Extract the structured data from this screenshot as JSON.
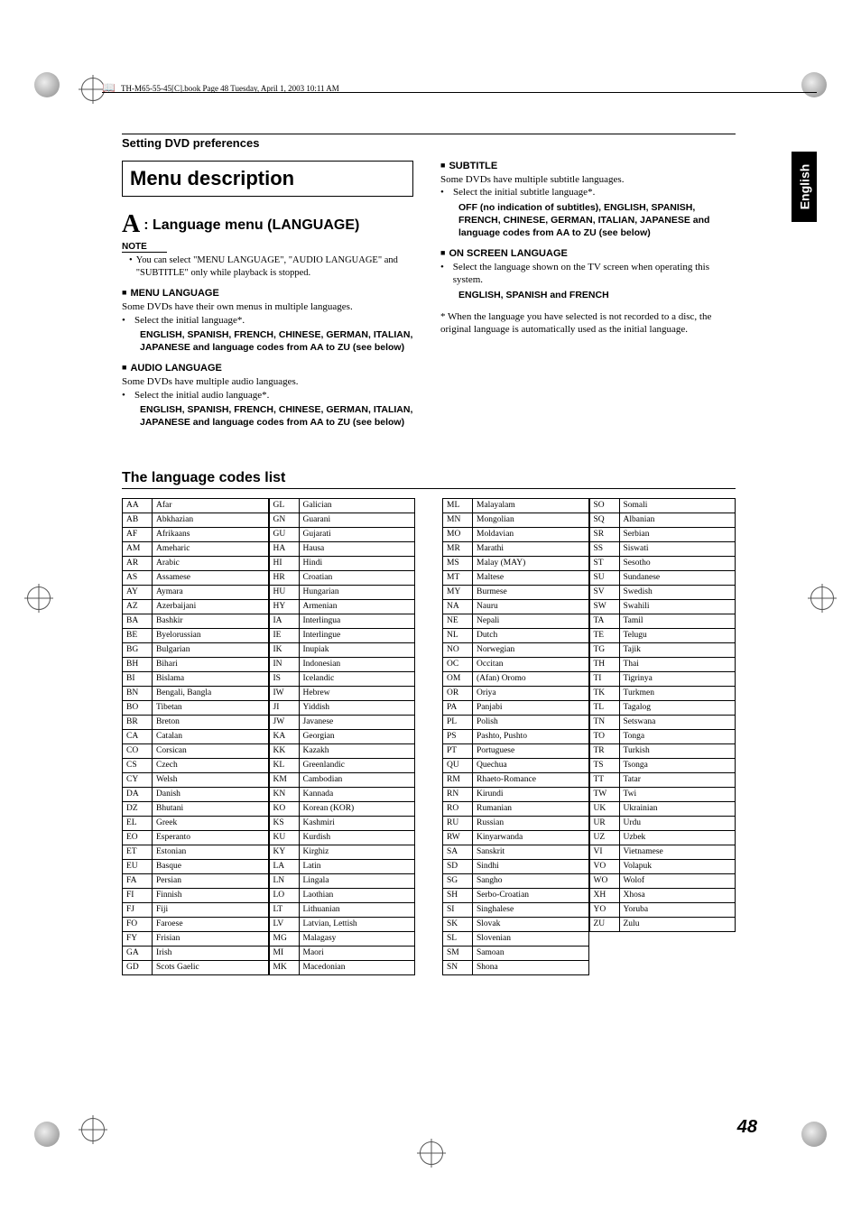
{
  "header": {
    "doc_info": "TH-M65-55-45[C].book  Page 48  Tuesday, April 1, 2003  10:11 AM"
  },
  "side_tab": "English",
  "section_label": "Setting DVD preferences",
  "title": "Menu description",
  "lang_menu_heading": ": Language menu (LANGUAGE)",
  "note_label": "NOTE",
  "note_text": "You can select \"MENU LANGUAGE\", \"AUDIO LANGUAGE\" and \"SUBTITLE\" only while playback is stopped.",
  "menu_lang": {
    "head": "MENU LANGUAGE",
    "line1": "Some DVDs have their own menus in multiple languages.",
    "line2": "Select the initial language*.",
    "bold": "ENGLISH, SPANISH, FRENCH, CHINESE, GERMAN, ITALIAN, JAPANESE and language codes from AA to ZU (see below)"
  },
  "audio_lang": {
    "head": "AUDIO LANGUAGE",
    "line1": "Some DVDs have multiple audio languages.",
    "line2": "Select the initial audio language*.",
    "bold": "ENGLISH, SPANISH, FRENCH, CHINESE, GERMAN, ITALIAN, JAPANESE and language codes from AA to ZU (see below)"
  },
  "subtitle": {
    "head": "SUBTITLE",
    "line1": "Some DVDs have multiple subtitle languages.",
    "line2": "Select the initial subtitle language*.",
    "bold": "OFF (no indication of subtitles), ENGLISH, SPANISH, FRENCH, CHINESE, GERMAN, ITALIAN, JAPANESE and language codes from AA to ZU (see below)"
  },
  "osd": {
    "head": "ON SCREEN LANGUAGE",
    "line1": "Select the language shown on the TV screen when operating this system.",
    "bold": "ENGLISH, SPANISH and FRENCH"
  },
  "footnote": "* When the language you have selected is not recorded to a disc, the original language is automatically used as the initial language.",
  "codes_heading": "The language codes list",
  "codes": [
    [
      "AA",
      "Afar"
    ],
    [
      "AB",
      "Abkhazian"
    ],
    [
      "AF",
      "Afrikaans"
    ],
    [
      "AM",
      "Ameharic"
    ],
    [
      "AR",
      "Arabic"
    ],
    [
      "AS",
      "Assamese"
    ],
    [
      "AY",
      "Aymara"
    ],
    [
      "AZ",
      "Azerbaijani"
    ],
    [
      "BA",
      "Bashkir"
    ],
    [
      "BE",
      "Byelorussian"
    ],
    [
      "BG",
      "Bulgarian"
    ],
    [
      "BH",
      "Bihari"
    ],
    [
      "BI",
      "Bislama"
    ],
    [
      "BN",
      "Bengali, Bangla"
    ],
    [
      "BO",
      "Tibetan"
    ],
    [
      "BR",
      "Breton"
    ],
    [
      "CA",
      "Catalan"
    ],
    [
      "CO",
      "Corsican"
    ],
    [
      "CS",
      "Czech"
    ],
    [
      "CY",
      "Welsh"
    ],
    [
      "DA",
      "Danish"
    ],
    [
      "DZ",
      "Bhutani"
    ],
    [
      "EL",
      "Greek"
    ],
    [
      "EO",
      "Esperanto"
    ],
    [
      "ET",
      "Estonian"
    ],
    [
      "EU",
      "Basque"
    ],
    [
      "FA",
      "Persian"
    ],
    [
      "FI",
      "Finnish"
    ],
    [
      "FJ",
      "Fiji"
    ],
    [
      "FO",
      "Faroese"
    ],
    [
      "FY",
      "Frisian"
    ],
    [
      "GA",
      "Irish"
    ],
    [
      "GD",
      "Scots Gaelic"
    ],
    [
      "GL",
      "Galician"
    ],
    [
      "GN",
      "Guarani"
    ],
    [
      "GU",
      "Gujarati"
    ],
    [
      "HA",
      "Hausa"
    ],
    [
      "HI",
      "Hindi"
    ],
    [
      "HR",
      "Croatian"
    ],
    [
      "HU",
      "Hungarian"
    ],
    [
      "HY",
      "Armenian"
    ],
    [
      "IA",
      "Interlingua"
    ],
    [
      "IE",
      "Interlingue"
    ],
    [
      "IK",
      "Inupiak"
    ],
    [
      "IN",
      "Indonesian"
    ],
    [
      "IS",
      "Icelandic"
    ],
    [
      "IW",
      "Hebrew"
    ],
    [
      "JI",
      "Yiddish"
    ],
    [
      "JW",
      "Javanese"
    ],
    [
      "KA",
      "Georgian"
    ],
    [
      "KK",
      "Kazakh"
    ],
    [
      "KL",
      "Greenlandic"
    ],
    [
      "KM",
      "Cambodian"
    ],
    [
      "KN",
      "Kannada"
    ],
    [
      "KO",
      "Korean (KOR)"
    ],
    [
      "KS",
      "Kashmiri"
    ],
    [
      "KU",
      "Kurdish"
    ],
    [
      "KY",
      "Kirghiz"
    ],
    [
      "LA",
      "Latin"
    ],
    [
      "LN",
      "Lingala"
    ],
    [
      "LO",
      "Laothian"
    ],
    [
      "LT",
      "Lithuanian"
    ],
    [
      "LV",
      "Latvian, Lettish"
    ],
    [
      "MG",
      "Malagasy"
    ],
    [
      "MI",
      "Maori"
    ],
    [
      "MK",
      "Macedonian"
    ],
    [
      "ML",
      "Malayalam"
    ],
    [
      "MN",
      "Mongolian"
    ],
    [
      "MO",
      "Moldavian"
    ],
    [
      "MR",
      "Marathi"
    ],
    [
      "MS",
      "Malay (MAY)"
    ],
    [
      "MT",
      "Maltese"
    ],
    [
      "MY",
      "Burmese"
    ],
    [
      "NA",
      "Nauru"
    ],
    [
      "NE",
      "Nepali"
    ],
    [
      "NL",
      "Dutch"
    ],
    [
      "NO",
      "Norwegian"
    ],
    [
      "OC",
      "Occitan"
    ],
    [
      "OM",
      "(Afan) Oromo"
    ],
    [
      "OR",
      "Oriya"
    ],
    [
      "PA",
      "Panjabi"
    ],
    [
      "PL",
      "Polish"
    ],
    [
      "PS",
      "Pashto, Pushto"
    ],
    [
      "PT",
      "Portuguese"
    ],
    [
      "QU",
      "Quechua"
    ],
    [
      "RM",
      "Rhaeto-Romance"
    ],
    [
      "RN",
      "Kirundi"
    ],
    [
      "RO",
      "Rumanian"
    ],
    [
      "RU",
      "Russian"
    ],
    [
      "RW",
      "Kinyarwanda"
    ],
    [
      "SA",
      "Sanskrit"
    ],
    [
      "SD",
      "Sindhi"
    ],
    [
      "SG",
      "Sangho"
    ],
    [
      "SH",
      "Serbo-Croatian"
    ],
    [
      "SI",
      "Singhalese"
    ],
    [
      "SK",
      "Slovak"
    ],
    [
      "SL",
      "Slovenian"
    ],
    [
      "SM",
      "Samoan"
    ],
    [
      "SN",
      "Shona"
    ],
    [
      "SO",
      "Somali"
    ],
    [
      "SQ",
      "Albanian"
    ],
    [
      "SR",
      "Serbian"
    ],
    [
      "SS",
      "Siswati"
    ],
    [
      "ST",
      "Sesotho"
    ],
    [
      "SU",
      "Sundanese"
    ],
    [
      "SV",
      "Swedish"
    ],
    [
      "SW",
      "Swahili"
    ],
    [
      "TA",
      "Tamil"
    ],
    [
      "TE",
      "Telugu"
    ],
    [
      "TG",
      "Tajik"
    ],
    [
      "TH",
      "Thai"
    ],
    [
      "TI",
      "Tigrinya"
    ],
    [
      "TK",
      "Turkmen"
    ],
    [
      "TL",
      "Tagalog"
    ],
    [
      "TN",
      "Setswana"
    ],
    [
      "TO",
      "Tonga"
    ],
    [
      "TR",
      "Turkish"
    ],
    [
      "TS",
      "Tsonga"
    ],
    [
      "TT",
      "Tatar"
    ],
    [
      "TW",
      "Twi"
    ],
    [
      "UK",
      "Ukrainian"
    ],
    [
      "UR",
      "Urdu"
    ],
    [
      "UZ",
      "Uzbek"
    ],
    [
      "VI",
      "Vietnamese"
    ],
    [
      "VO",
      "Volapuk"
    ],
    [
      "WO",
      "Wolof"
    ],
    [
      "XH",
      "Xhosa"
    ],
    [
      "YO",
      "Yoruba"
    ],
    [
      "ZU",
      "Zulu"
    ]
  ],
  "page_number": "48"
}
